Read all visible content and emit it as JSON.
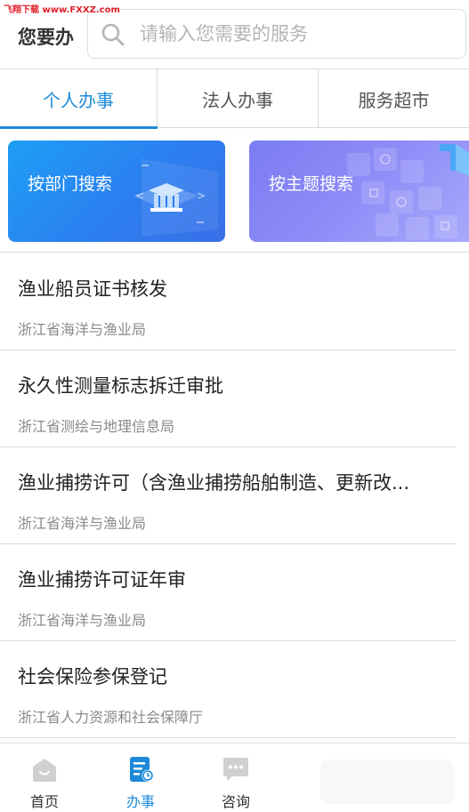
{
  "watermark": "飞翔下载 www.FXXZ.com",
  "header": {
    "title": "您要办",
    "search_placeholder": "请输入您需要的服务"
  },
  "tabs": [
    {
      "label": "个人办事",
      "active": true
    },
    {
      "label": "法人办事",
      "active": false
    },
    {
      "label": "服务超市",
      "active": false
    }
  ],
  "banners": {
    "dept": "按部门搜索",
    "topic": "按主题搜索"
  },
  "services": [
    {
      "title": "渔业船员证书核发",
      "dept": "浙江省海洋与渔业局"
    },
    {
      "title": "永久性测量标志拆迁审批",
      "dept": "浙江省测绘与地理信息局"
    },
    {
      "title": "渔业捕捞许可（含渔业捕捞船舶制造、更新改...",
      "dept": "浙江省海洋与渔业局"
    },
    {
      "title": "渔业捕捞许可证年审",
      "dept": "浙江省海洋与渔业局"
    },
    {
      "title": "社会保险参保登记",
      "dept": "浙江省人力资源和社会保障厅"
    }
  ],
  "bottom_nav": [
    {
      "label": "首页",
      "icon": "home-icon"
    },
    {
      "label": "办事",
      "icon": "document-clock-icon",
      "active": true
    },
    {
      "label": "咨询",
      "icon": "chat-bubble-icon"
    }
  ],
  "colors": {
    "accent": "#1c8ad9",
    "banner_dept": "#2b7ff0",
    "banner_topic": "#8e8cf7"
  }
}
